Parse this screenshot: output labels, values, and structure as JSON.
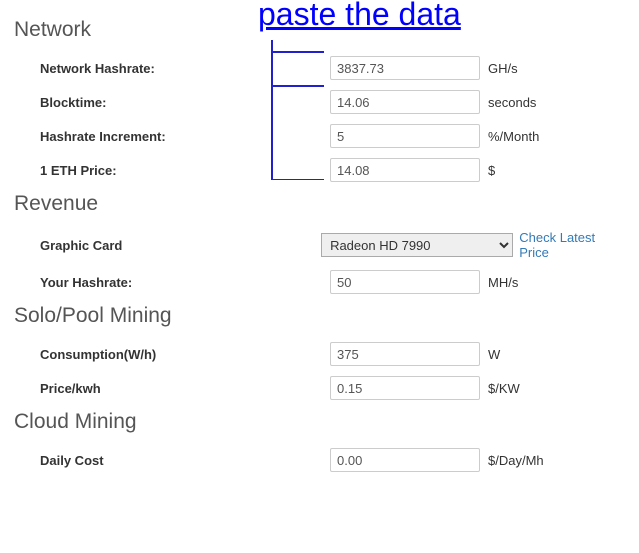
{
  "annotation": "paste the data",
  "sections": {
    "network": {
      "title": "Network",
      "fields": {
        "hashrate": {
          "label": "Network Hashrate:",
          "value": "3837.73",
          "unit": "GH/s"
        },
        "blocktime": {
          "label": "Blocktime:",
          "value": "14.06",
          "unit": "seconds"
        },
        "increment": {
          "label": "Hashrate Increment:",
          "value": "5",
          "unit": "%/Month"
        },
        "ethprice": {
          "label": "1 ETH Price:",
          "value": "14.08",
          "unit": "$"
        }
      }
    },
    "revenue": {
      "title": "Revenue",
      "fields": {
        "card": {
          "label": "Graphic Card",
          "selected": "Radeon HD 7990",
          "link": "Check Latest Price"
        },
        "hashrate": {
          "label": "Your Hashrate:",
          "value": "50",
          "unit": "MH/s"
        }
      }
    },
    "solopool": {
      "title": "Solo/Pool Mining",
      "fields": {
        "consumption": {
          "label": "Consumption(W/h)",
          "value": "375",
          "unit": "W"
        },
        "pricekwh": {
          "label": "Price/kwh",
          "value": "0.15",
          "unit": "$/KW"
        }
      }
    },
    "cloud": {
      "title": "Cloud Mining",
      "fields": {
        "dailycost": {
          "label": "Daily Cost",
          "value": "0.00",
          "unit": "$/Day/Mh"
        }
      }
    }
  }
}
